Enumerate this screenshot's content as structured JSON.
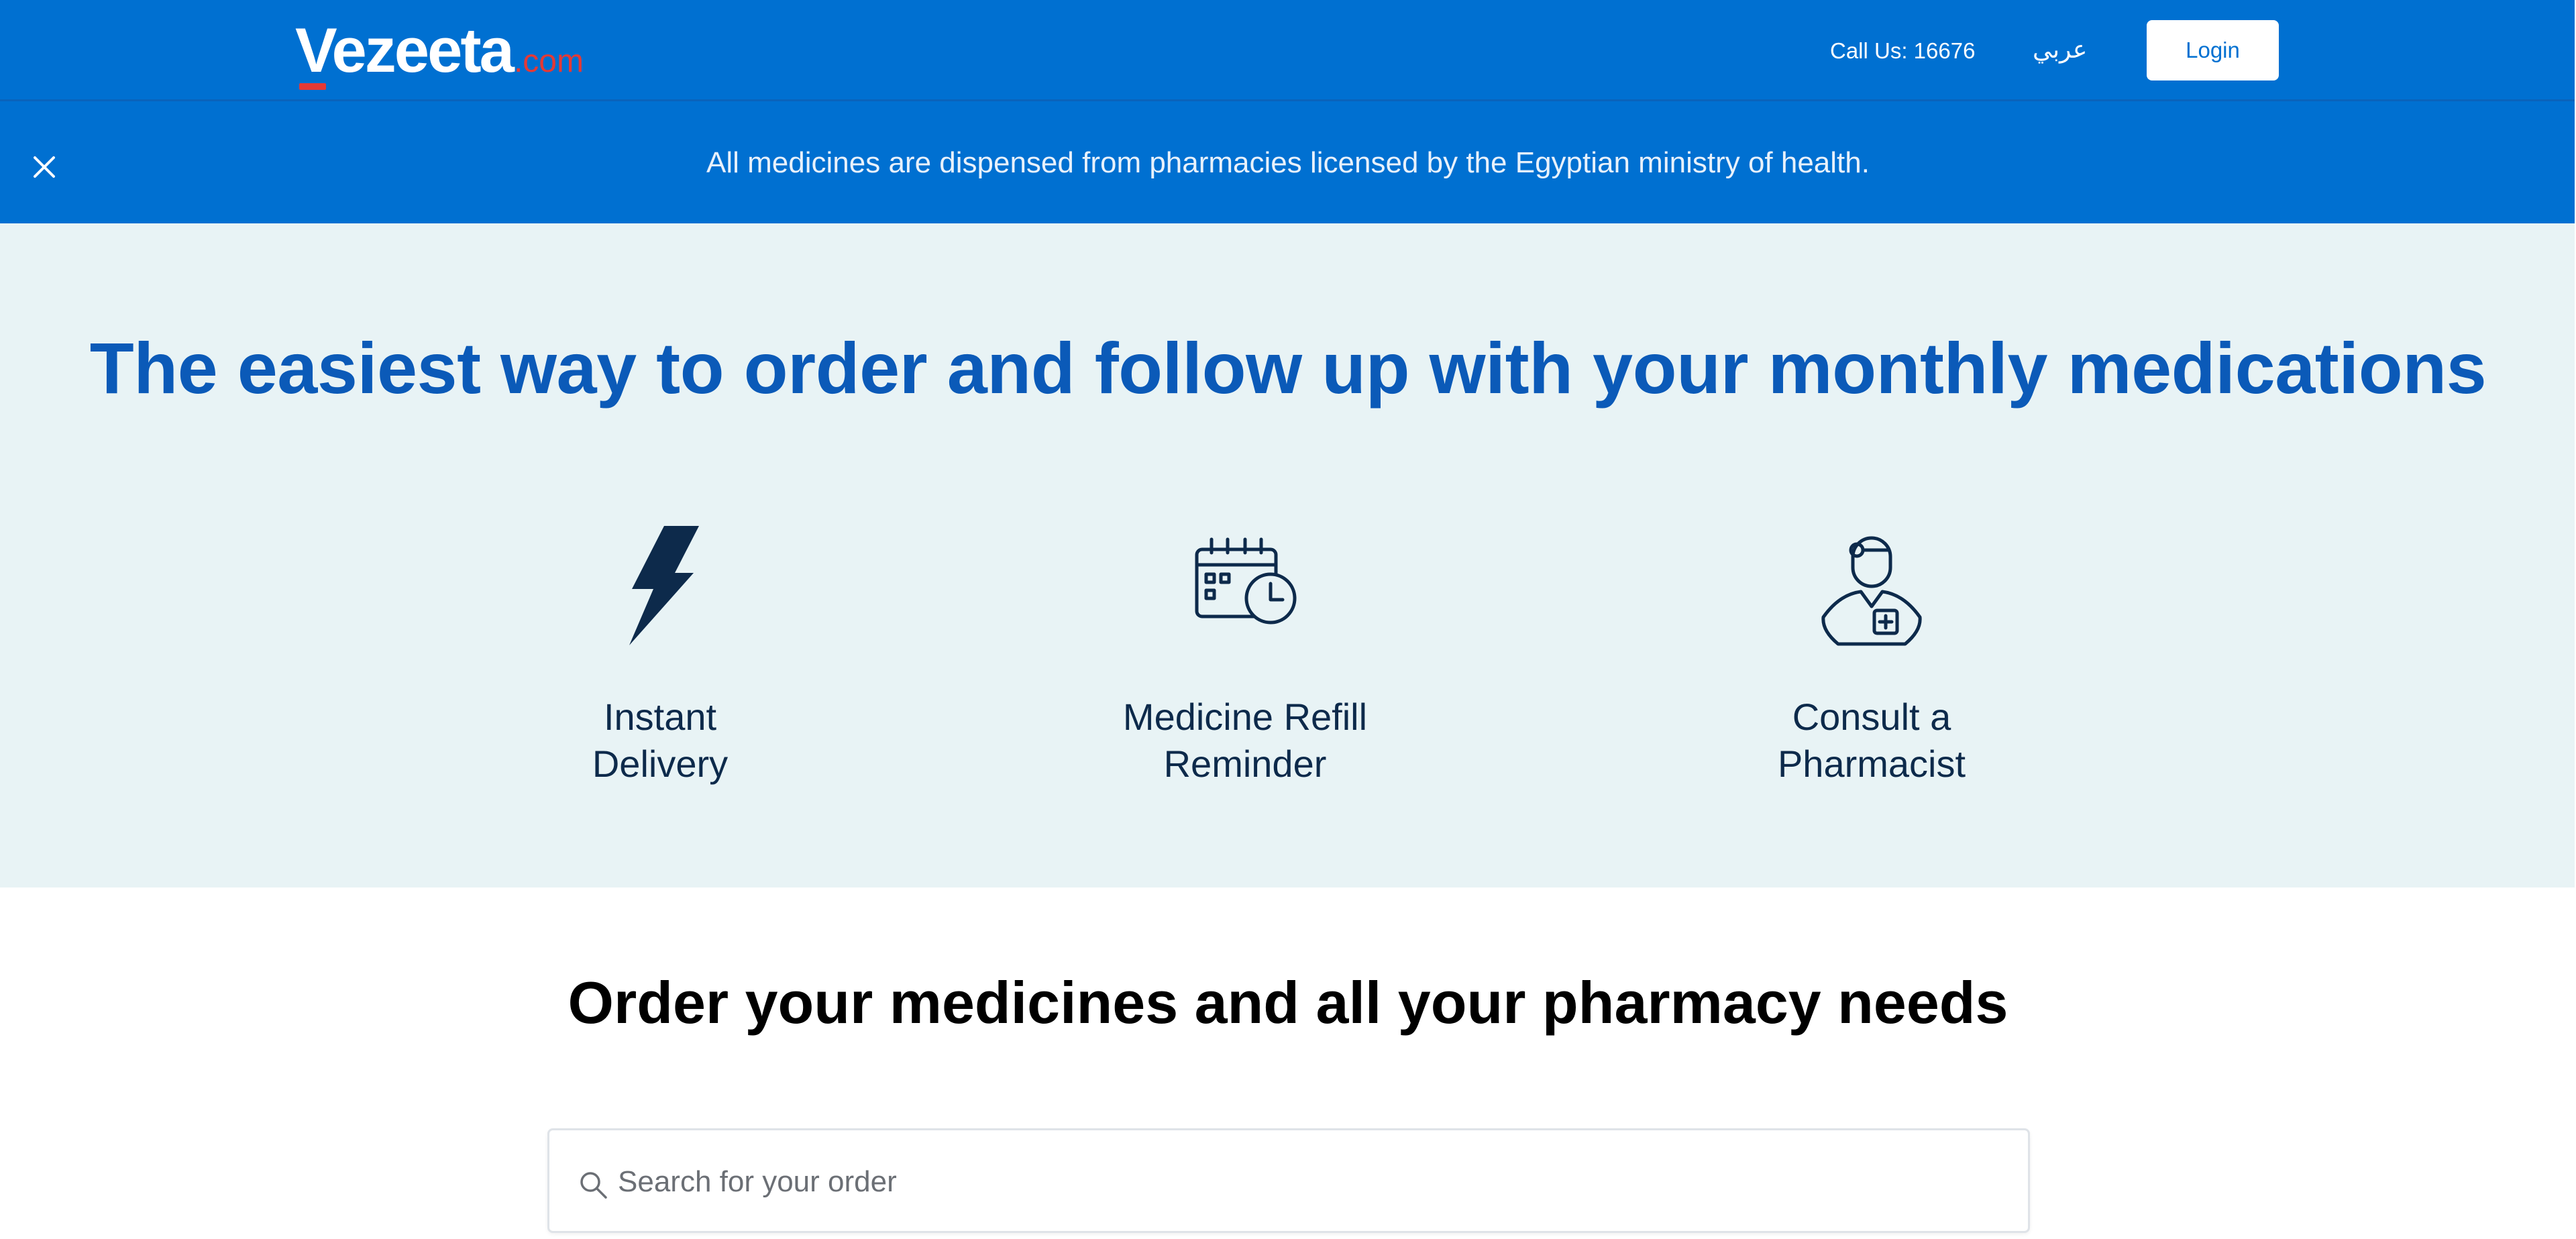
{
  "header": {
    "logo": {
      "brand": "Vezeeta",
      "suffix": ".com"
    },
    "call_us": "Call Us: 16676",
    "language_toggle": "عربي",
    "login_label": "Login"
  },
  "notice": {
    "text": "All medicines are dispensed from pharmacies licensed by the Egyptian ministry of health.",
    "close_icon": "close-icon"
  },
  "hero": {
    "title": "The easiest way to order and follow up with your monthly medications",
    "features": [
      {
        "icon": "lightning-icon",
        "label_line1": "Instant",
        "label_line2": "Delivery"
      },
      {
        "icon": "calendar-clock-icon",
        "label_line1": "Medicine Refill",
        "label_line2": "Reminder"
      },
      {
        "icon": "pharmacist-icon",
        "label_line1": "Consult a",
        "label_line2": "Pharmacist"
      }
    ]
  },
  "order": {
    "title": "Order your medicines and all your pharmacy needs",
    "search": {
      "placeholder": "Search for your order",
      "value": "",
      "icon": "search-icon"
    }
  },
  "colors": {
    "header_bg": "#0070d1",
    "hero_bg": "#e8f3f5",
    "hero_title": "#0b5ab8",
    "icon_navy": "#0d2a4b",
    "logo_accent": "#e53935"
  }
}
